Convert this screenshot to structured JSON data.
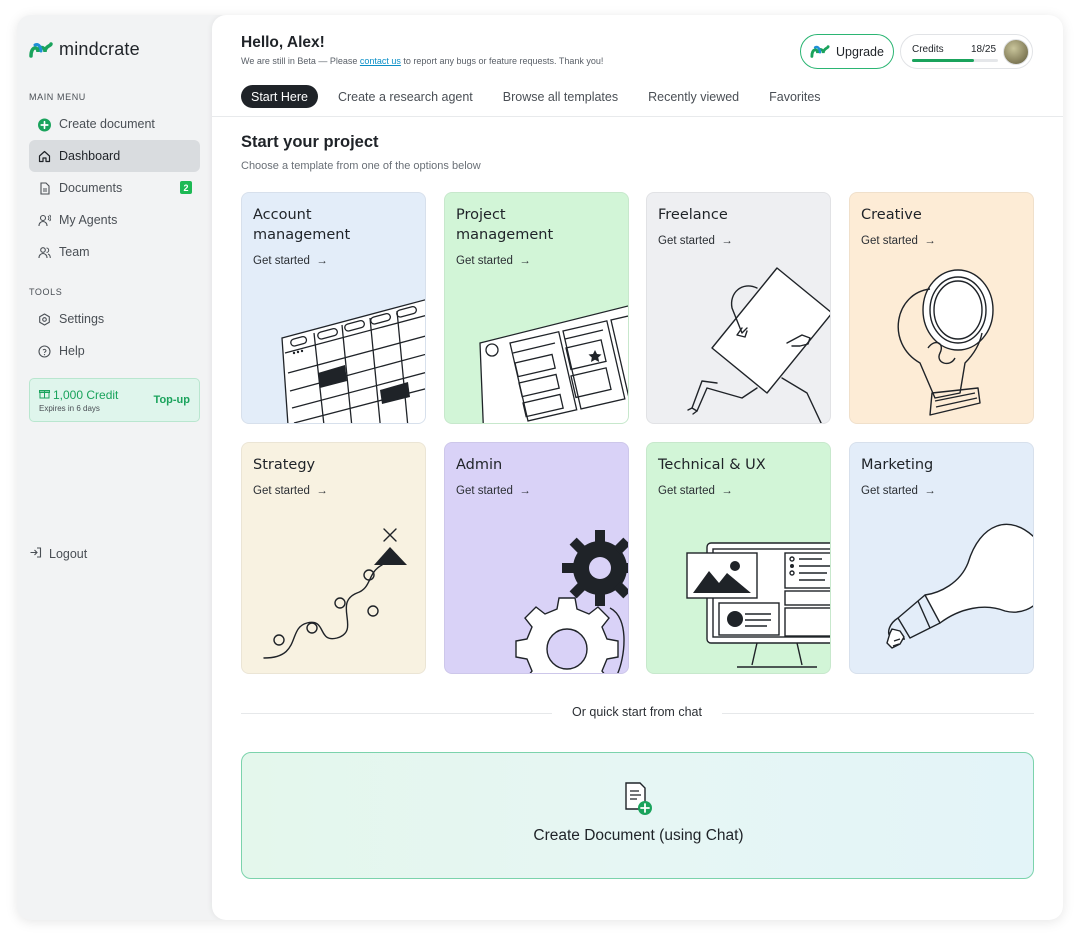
{
  "brand": {
    "name": "mindcrate",
    "color": "#1aa35c"
  },
  "sidebar": {
    "main_menu_title": "MAIN MENU",
    "create_document": "Create document",
    "items": [
      {
        "label": "Dashboard",
        "icon": "home-icon",
        "active": true
      },
      {
        "label": "Documents",
        "icon": "document-icon",
        "badge": "2"
      },
      {
        "label": "My Agents",
        "icon": "agent-icon"
      },
      {
        "label": "Team",
        "icon": "team-icon"
      }
    ],
    "tools_title": "TOOLS",
    "tools": [
      {
        "label": "Settings",
        "icon": "gear-icon"
      },
      {
        "label": "Help",
        "icon": "help-icon"
      }
    ],
    "credit": {
      "amount": "1,000 Credit",
      "expires": "Expires in 6 days",
      "topup": "Top-up"
    },
    "logout": "Logout"
  },
  "header": {
    "greeting": "Hello, Alex!",
    "beta_prefix": "We are still in Beta — Please ",
    "beta_link": "contact us",
    "beta_suffix": " to report any bugs or feature requests. Thank you!",
    "upgrade": "Upgrade",
    "credits_label": "Credits",
    "credits_count": "18/25",
    "credits_progress": 0.72
  },
  "tabs": [
    "Start Here",
    "Create a research agent",
    "Browse all templates",
    "Recently viewed",
    "Favorites"
  ],
  "section": {
    "title": "Start your project",
    "subtitle": "Choose a template from one of the options below"
  },
  "templates": [
    {
      "title": "Account management",
      "cta": "Get started",
      "bg": "#e3edf9"
    },
    {
      "title": "Project management",
      "cta": "Get started",
      "bg": "#d2f5d7"
    },
    {
      "title": "Freelance",
      "cta": "Get started",
      "bg": "#eeeff2"
    },
    {
      "title": "Creative",
      "cta": "Get started",
      "bg": "#fdecd6"
    },
    {
      "title": "Strategy",
      "cta": "Get started",
      "bg": "#f8f2e1"
    },
    {
      "title": "Admin",
      "cta": "Get started",
      "bg": "#d9d2f7"
    },
    {
      "title": "Technical & UX",
      "cta": "Get started",
      "bg": "#d2f5d7"
    },
    {
      "title": "Marketing",
      "cta": "Get started",
      "bg": "#e3edf9"
    }
  ],
  "quick_start": "Or quick start from chat",
  "chat_cta": "Create Document (using Chat)"
}
